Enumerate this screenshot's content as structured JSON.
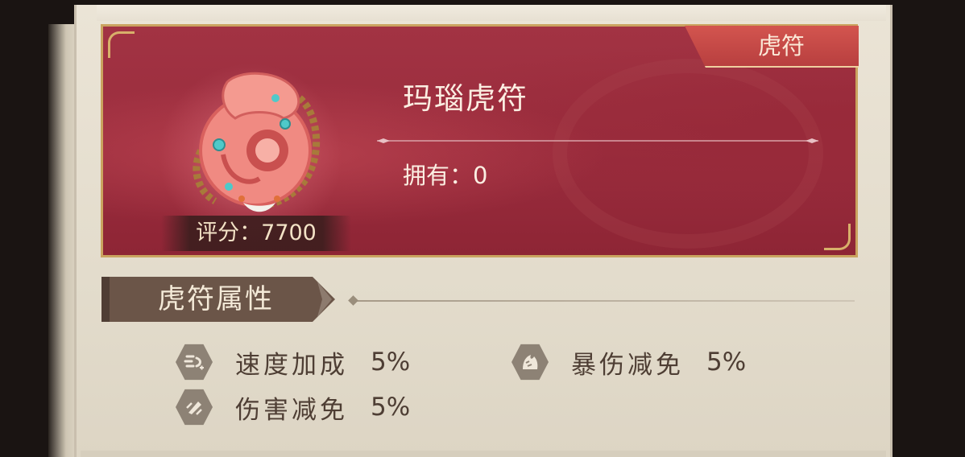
{
  "card": {
    "category_tag": "虎符",
    "item_name": "玛瑙虎符",
    "owned_text": "拥有：0",
    "score_text": "评分：7700"
  },
  "attributes_section": {
    "title": "虎符属性",
    "items": [
      {
        "icon": "speed-icon",
        "label": "速度加成",
        "value": "5%"
      },
      {
        "icon": "crit-resist-icon",
        "label": "暴伤减免",
        "value": "5%"
      },
      {
        "icon": "damage-reduction-icon",
        "label": "伤害减免",
        "value": "5%"
      }
    ]
  },
  "colors": {
    "card_red": "#9a2c3d",
    "tag_red": "#c94a47",
    "gold_border": "#caa35f",
    "panel_bg": "#e6dfd0",
    "text_brown": "#4e3e34"
  }
}
